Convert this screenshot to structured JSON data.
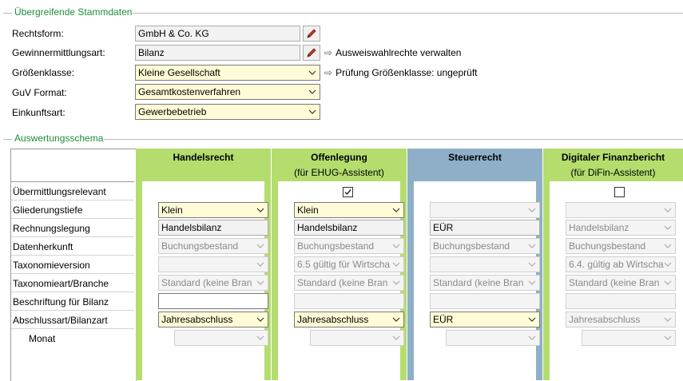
{
  "stammdaten": {
    "title": "Übergreifende Stammdaten",
    "rechtsform_label": "Rechtsform:",
    "rechtsform_value": "GmbH & Co. KG",
    "gewinnermittlungsart_label": "Gewinnermittlungsart:",
    "gewinnermittlungsart_value": "Bilanz",
    "ausweiswahlrechte_link": "Ausweiswahlrechte verwalten",
    "groessenklasse_label": "Größenklasse:",
    "groessenklasse_value": "Kleine Gesellschaft",
    "pruefung_link": "Prüfung Größenklasse: ungeprüft",
    "guv_label": "GuV Format:",
    "guv_value": "Gesamtkostenverfahren",
    "einkunftsart_label": "Einkunftsart:",
    "einkunftsart_value": "Gewerbebetrieb"
  },
  "schema": {
    "title": "Auswertungsschema",
    "rows": [
      "Übermittlungsrelevant",
      "Gliederungstiefe",
      "Rechnungslegung",
      "Datenherkunft",
      "Taxonomieversion",
      "Taxonomieart/Branche",
      "Beschriftung für Bilanz",
      "Abschlussart/Bilanzart",
      "Monat"
    ],
    "columns": [
      {
        "title": "Handelsrecht",
        "subtitle": "",
        "color": "#b4dd6e",
        "gliederung": "Klein",
        "rechnungslegung": "Handelsbilanz",
        "datenherkunft": "Buchungsbestand",
        "taxversion": "",
        "taxart": "Standard (keine Bran",
        "abschlussart": "Jahresabschluss"
      },
      {
        "title": "Offenlegung",
        "subtitle": "(für EHUG-Assistent)",
        "color": "#b4dd6e",
        "gliederung": "Klein",
        "rechnungslegung": "Handelsbilanz",
        "datenherkunft": "Buchungsbestand",
        "taxversion": "6.5 gültig für Wirtscha",
        "taxart": "Standard (keine Bran",
        "abschlussart": "Jahresabschluss"
      },
      {
        "title": "Steuerrecht",
        "subtitle": "",
        "color": "#8eafc7",
        "gliederung": "",
        "rechnungslegung": "EÜR",
        "datenherkunft": "Buchungsbestand",
        "taxversion": "",
        "taxart": "Standard (keine Bran",
        "abschlussart": "EÜR"
      },
      {
        "title": "Digitaler Finanzbericht",
        "subtitle": "(für DiFin-Assistent)",
        "color": "#b4dd6e",
        "gliederung": "",
        "rechnungslegung": "Handelsbilanz",
        "datenherkunft": "Buchungsbestand",
        "taxversion": "6.4. gültig ab Wirtscha",
        "taxart": "Standard (keine Bran",
        "abschlussart": "Jahresabschluss"
      }
    ]
  }
}
